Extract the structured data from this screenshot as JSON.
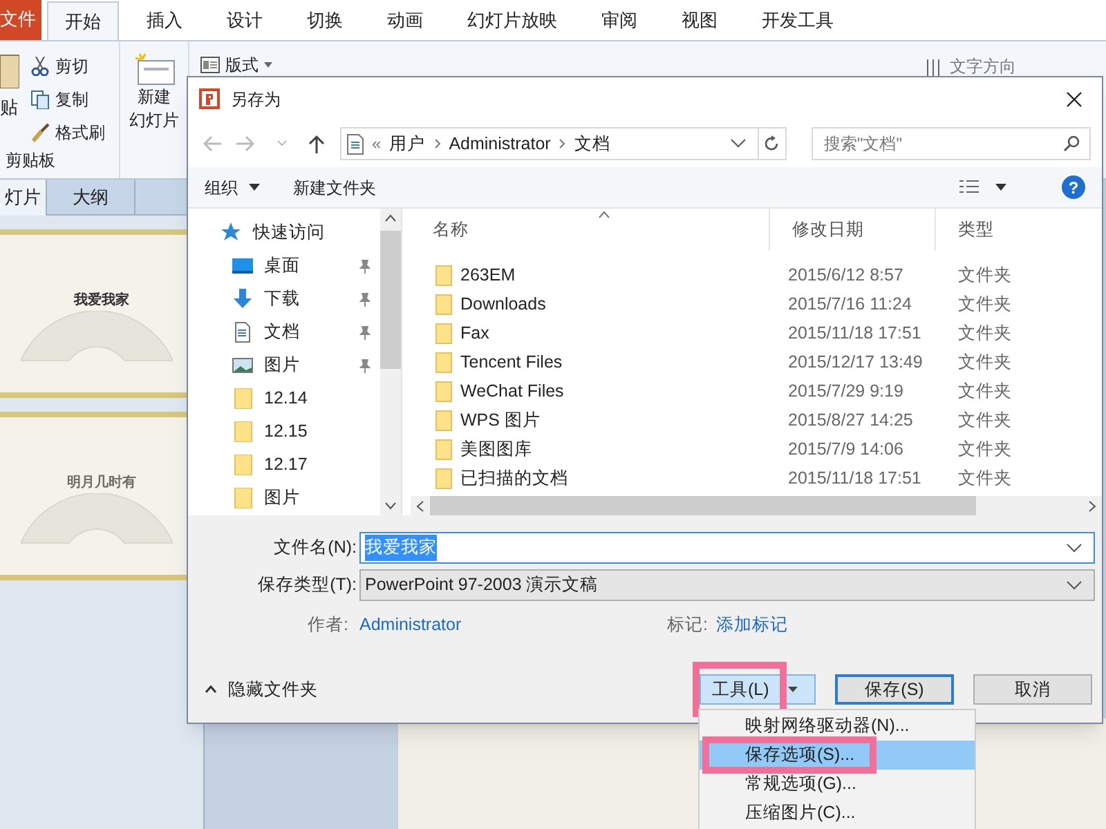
{
  "ribbon_tabs": [
    {
      "label": "文件",
      "kind": "file",
      "selected": false
    },
    {
      "label": "开始",
      "kind": "tab",
      "selected": true
    },
    {
      "label": "插入",
      "kind": "tab",
      "selected": false
    },
    {
      "label": "设计",
      "kind": "tab",
      "selected": false
    },
    {
      "label": "切换",
      "kind": "tab",
      "selected": false
    },
    {
      "label": "动画",
      "kind": "tab",
      "selected": false
    },
    {
      "label": "幻灯片放映",
      "kind": "tab",
      "selected": false
    },
    {
      "label": "审阅",
      "kind": "tab",
      "selected": false
    },
    {
      "label": "视图",
      "kind": "tab",
      "selected": false
    },
    {
      "label": "开发工具",
      "kind": "tab",
      "selected": false
    }
  ],
  "clipboard": {
    "paste": "贴",
    "cut": "剪切",
    "copy": "复制",
    "format_painter": "格式刷",
    "group_label": "剪贴板"
  },
  "slides_group": {
    "new_slide": [
      "新建",
      "幻灯片"
    ],
    "layout": "版式"
  },
  "paragraph_group": {
    "text_direction": "文字方向"
  },
  "side_tabs": [
    {
      "label": "灯片",
      "selected": true
    },
    {
      "label": "大纲",
      "selected": false
    }
  ],
  "slides": [
    {
      "title": "我爱我家"
    },
    {
      "title": "明月几时有"
    }
  ],
  "dialog": {
    "title": "另存为",
    "address_overflow": "«",
    "address": [
      "用户",
      "Administrator",
      "文档"
    ],
    "search_placeholder": "搜索\"文档\"",
    "toolbar": {
      "organize": "组织",
      "new_folder": "新建文件夹",
      "help": "?"
    },
    "nav_items": [
      {
        "label": "快速访问",
        "kind": "quick",
        "pinned": false
      },
      {
        "label": "桌面",
        "kind": "desktop",
        "pinned": true
      },
      {
        "label": "下载",
        "kind": "download",
        "pinned": true
      },
      {
        "label": "文档",
        "kind": "document",
        "pinned": true
      },
      {
        "label": "图片",
        "kind": "pictures",
        "pinned": true
      },
      {
        "label": "12.14",
        "kind": "folder",
        "pinned": false
      },
      {
        "label": "12.15",
        "kind": "folder",
        "pinned": false
      },
      {
        "label": "12.17",
        "kind": "folder",
        "pinned": false
      },
      {
        "label": "图片",
        "kind": "folder",
        "pinned": false
      }
    ],
    "columns": [
      "名称",
      "修改日期",
      "类型"
    ],
    "rows": [
      [
        "263EM",
        "2015/6/12 8:57",
        "文件夹"
      ],
      [
        "Downloads",
        "2015/7/16 11:24",
        "文件夹"
      ],
      [
        "Fax",
        "2015/11/18 17:51",
        "文件夹"
      ],
      [
        "Tencent Files",
        "2015/12/17 13:49",
        "文件夹"
      ],
      [
        "WeChat Files",
        "2015/7/29 9:19",
        "文件夹"
      ],
      [
        "WPS 图片",
        "2015/8/27 14:25",
        "文件夹"
      ],
      [
        "美图图库",
        "2015/7/9 14:06",
        "文件夹"
      ],
      [
        "已扫描的文档",
        "2015/11/18 17:51",
        "文件夹"
      ]
    ],
    "filename": {
      "label": "文件名(N):",
      "value": "我爱我家"
    },
    "filetype": {
      "label": "保存类型(T):",
      "value": "PowerPoint 97-2003 演示文稿"
    },
    "author": {
      "label": "作者:",
      "value": "Administrator"
    },
    "tags": {
      "label": "标记:",
      "value": "添加标记"
    },
    "hide_folders": "隐藏文件夹",
    "buttons": [
      {
        "label": "工具(L)",
        "kind": "tools",
        "highlighted": true
      },
      {
        "label": "保存(S)",
        "kind": "save",
        "highlighted": false
      },
      {
        "label": "取消",
        "kind": "cancel",
        "highlighted": false
      }
    ],
    "menu": [
      {
        "label": "映射网络驱动器(N)...",
        "selected": false,
        "highlighted": false
      },
      {
        "label": "保存选项(S)...",
        "selected": true,
        "highlighted": true
      },
      {
        "label": "常规选项(G)...",
        "selected": false,
        "highlighted": false
      },
      {
        "label": "压缩图片(C)...",
        "selected": false,
        "highlighted": false
      }
    ]
  }
}
